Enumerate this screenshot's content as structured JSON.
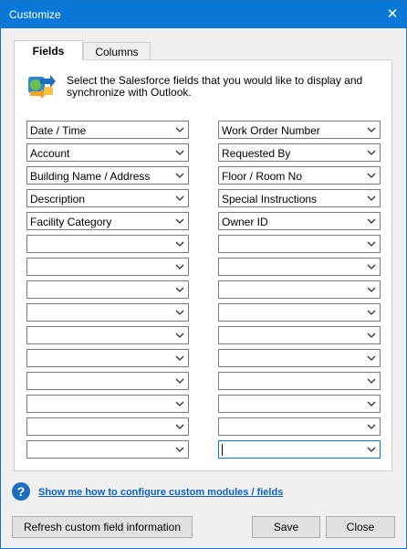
{
  "window": {
    "title": "Customize",
    "close_glyph": "✕"
  },
  "tabs": [
    {
      "label": "Fields",
      "active": true
    },
    {
      "label": "Columns",
      "active": false
    }
  ],
  "panel": {
    "description_line1": "Select the Salesforce fields that you would like to display and",
    "description_line2": "synchronize with Outlook.",
    "icon": "sync-arrows-icon"
  },
  "left_fields": [
    "Date / Time",
    "Account",
    "Building Name / Address",
    "Description",
    "Facility Category",
    "",
    "",
    "",
    "",
    "",
    "",
    "",
    "",
    "",
    ""
  ],
  "right_fields": [
    "Work Order Number",
    "Requested By",
    "Floor / Room No",
    "Special Instructions",
    "Owner ID",
    "",
    "",
    "",
    "",
    "",
    "",
    "",
    "",
    "",
    ""
  ],
  "help": {
    "icon": "question-circle-icon",
    "glyph": "?",
    "link": "Show me how to configure custom modules / fields"
  },
  "buttons": {
    "refresh": "Refresh custom field information",
    "save": "Save",
    "close": "Close"
  },
  "colors": {
    "titlebar": "#0a78d7",
    "link": "#0b62c4",
    "help_icon": "#1c6fbf"
  }
}
